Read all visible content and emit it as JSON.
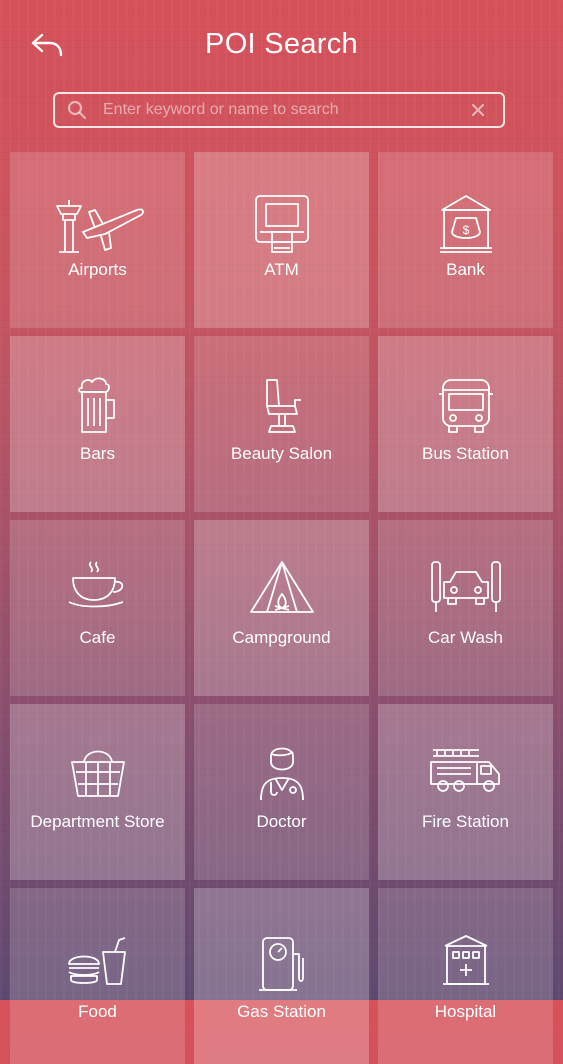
{
  "header": {
    "title": "POI Search",
    "back_icon": "back-arrow-icon"
  },
  "search": {
    "placeholder": "Enter keyword or name to search",
    "value": "",
    "search_icon": "search-icon",
    "clear_icon": "clear-icon"
  },
  "categories": [
    {
      "label": "Airports",
      "icon": "airport-icon"
    },
    {
      "label": "ATM",
      "icon": "atm-icon"
    },
    {
      "label": "Bank",
      "icon": "bank-icon"
    },
    {
      "label": "Bars",
      "icon": "beer-mug-icon"
    },
    {
      "label": "Beauty Salon",
      "icon": "salon-chair-icon"
    },
    {
      "label": "Bus Station",
      "icon": "bus-icon"
    },
    {
      "label": "Cafe",
      "icon": "coffee-cup-icon"
    },
    {
      "label": "Campground",
      "icon": "tent-icon"
    },
    {
      "label": "Car Wash",
      "icon": "car-wash-icon"
    },
    {
      "label": "Department Store",
      "icon": "shopping-basket-icon"
    },
    {
      "label": "Doctor",
      "icon": "doctor-icon"
    },
    {
      "label": "Fire Station",
      "icon": "fire-truck-icon"
    },
    {
      "label": "Food",
      "icon": "burger-drink-icon"
    },
    {
      "label": "Gas Station",
      "icon": "fuel-pump-icon"
    },
    {
      "label": "Hospital",
      "icon": "hospital-icon"
    }
  ]
}
